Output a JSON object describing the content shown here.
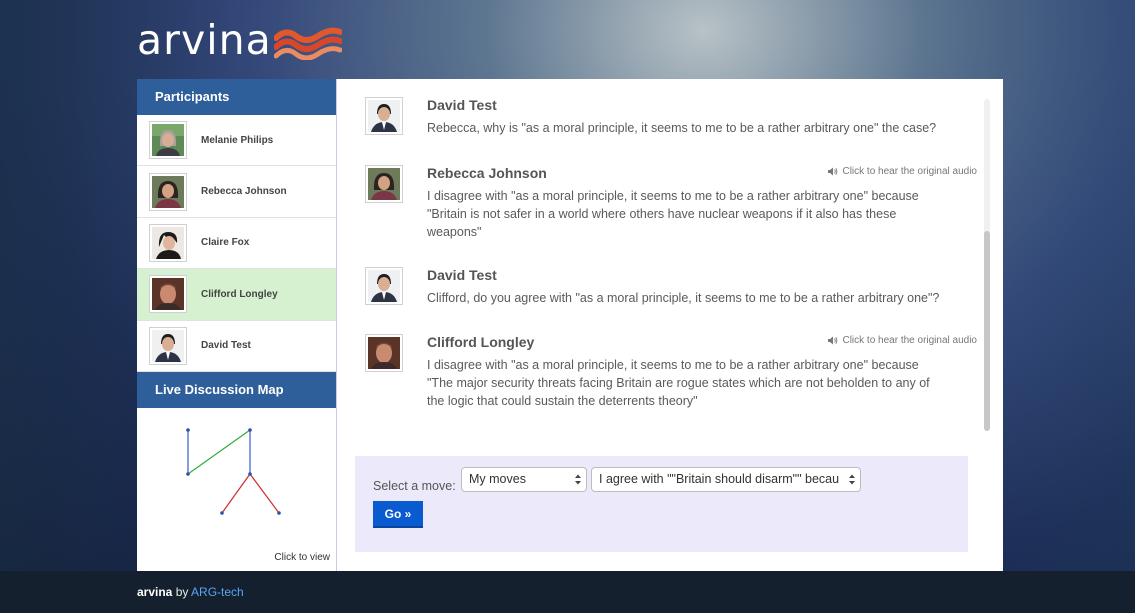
{
  "app": {
    "logo_text": "arvina"
  },
  "sidebar": {
    "participants_title": "Participants",
    "participants": [
      {
        "name": "Melanie Philips",
        "active": false
      },
      {
        "name": "Rebecca Johnson",
        "active": false
      },
      {
        "name": "Claire Fox",
        "active": false
      },
      {
        "name": "Clifford Longley",
        "active": true
      },
      {
        "name": "David Test",
        "active": false
      }
    ],
    "map_title": "Live Discussion Map",
    "map_link": "Click to view"
  },
  "chat": {
    "messages": [
      {
        "author": "David Test",
        "text": "Rebecca, why is \"as a moral principle, it seems to me to be a rather arbitrary one\" the case?",
        "audio_label": ""
      },
      {
        "author": "Rebecca Johnson",
        "text": "I disagree with \"as a moral principle, it seems to me to be a rather arbitrary one\" because \"Britain is not safer in a world where others have nuclear weapons if it also has these weapons\"",
        "audio_label": "Click to hear the original audio"
      },
      {
        "author": "David Test",
        "text": "Clifford, do you agree with \"as a moral principle, it seems to me to be a rather arbitrary one\"?",
        "audio_label": ""
      },
      {
        "author": "Clifford Longley",
        "text": "I disagree with \"as a moral principle, it seems to me to be a rather arbitrary one\" because \"The major security threats facing Britain are rogue states which are not beholden to any of the logic that could sustain the deterrents theory\"",
        "audio_label": "Click to hear the original audio"
      }
    ]
  },
  "move_form": {
    "label": "Select a move:",
    "move_type_value": "My moves",
    "move_value": "I agree with \"\"Britain should disarm\"\" becau",
    "go_label": "Go »"
  },
  "footer": {
    "brand": "arvina",
    "by": " by ",
    "link": "ARG-tech"
  },
  "colors": {
    "sidebar_header": "#2f5f9a",
    "active_participant": "#d6f1cf",
    "go_button": "#0a5bd0",
    "move_box": "#eceafa",
    "map_blue_edge": "#3a59c9",
    "map_green_edge": "#2fae3a",
    "map_red_edge": "#cf2a2a"
  }
}
